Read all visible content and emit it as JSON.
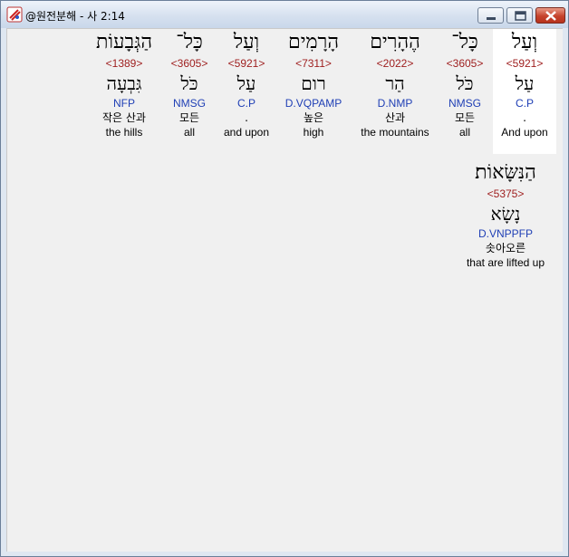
{
  "window": {
    "title": "@원전분해 - 사 2:14"
  },
  "words": [
    {
      "hebrew": "וְעַל",
      "strong": "<5921>",
      "lemma": "עַל",
      "parse": "C.P",
      "korean": ".",
      "english": "And upon",
      "selected": true
    },
    {
      "hebrew": "כָּל־",
      "strong": "<3605>",
      "lemma": "כֹּל",
      "parse": "NMSG",
      "korean": "모든",
      "english": "all",
      "selected": false
    },
    {
      "hebrew": "הֶהָרִים",
      "strong": "<2022>",
      "lemma": "הַר",
      "parse": "D.NMP",
      "korean": "산과",
      "english": "the mountains",
      "selected": false
    },
    {
      "hebrew": "הָרָמִים",
      "strong": "<7311>",
      "lemma": "רום",
      "parse": "D.VQPAMP",
      "korean": "높은",
      "english": "high",
      "selected": false
    },
    {
      "hebrew": "וְעַל",
      "strong": "<5921>",
      "lemma": "עַל",
      "parse": "C.P",
      "korean": ".",
      "english": "and upon",
      "selected": false
    },
    {
      "hebrew": "כָּל־",
      "strong": "<3605>",
      "lemma": "כֹּל",
      "parse": "NMSG",
      "korean": "모든",
      "english": "all",
      "selected": false
    },
    {
      "hebrew": "הַגְּבָעוֹת",
      "strong": "<1389>",
      "lemma": "גִּבְעָה",
      "parse": "NFP",
      "korean": "작은 산과",
      "english": "the hills",
      "selected": false
    },
    {
      "hebrew": "הַנִּשָּׂאוֹת׃",
      "strong": "<5375>",
      "lemma": "נָשָׂא",
      "parse": "D.VNPPFP",
      "korean": "솟아오른",
      "english": "that are lifted up",
      "selected": false
    }
  ]
}
